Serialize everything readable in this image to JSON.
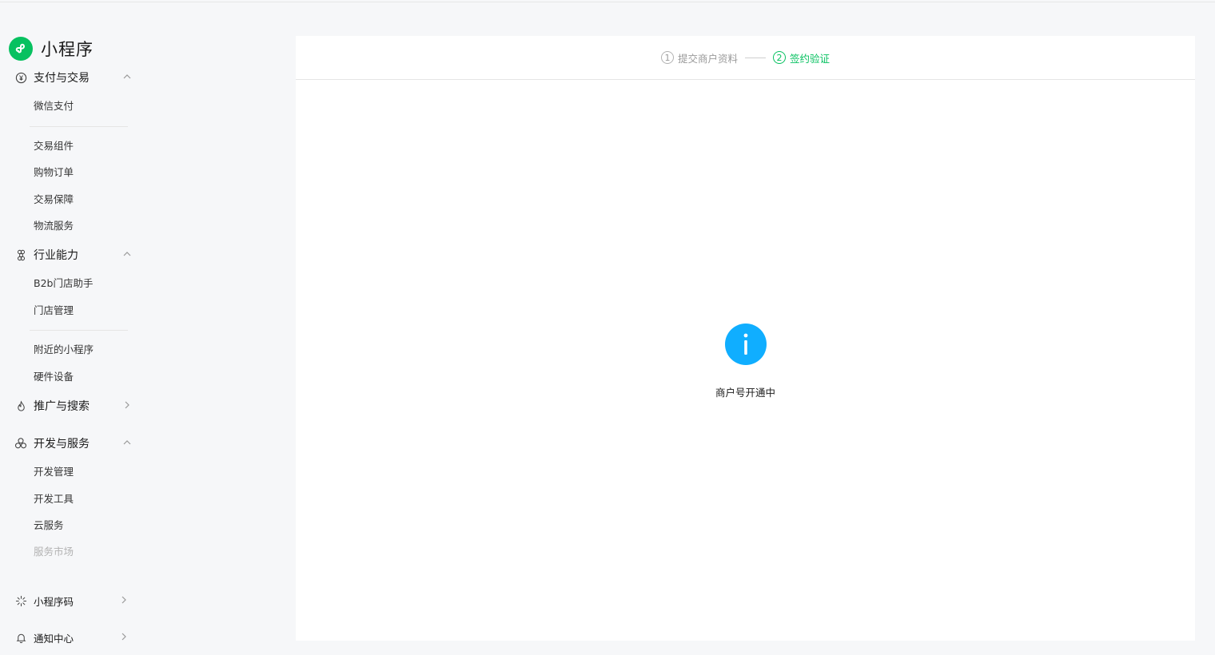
{
  "app": {
    "title": "小程序"
  },
  "sidebar": {
    "groups": [
      {
        "label": "支付与交易",
        "icon": "yen-circle-icon",
        "expanded": true,
        "items": [
          "微信支付",
          "交易组件",
          "购物订单",
          "交易保障",
          "物流服务"
        ]
      },
      {
        "label": "行业能力",
        "icon": "command-icon",
        "expanded": true,
        "items": [
          "B2b门店助手",
          "门店管理",
          "附近的小程序",
          "硬件设备"
        ]
      },
      {
        "label": "推广与搜索",
        "icon": "flame-icon",
        "expanded": false,
        "items": []
      },
      {
        "label": "开发与服务",
        "icon": "cluster-icon",
        "expanded": true,
        "items": [
          "开发管理",
          "开发工具",
          "云服务",
          "服务市场"
        ]
      },
      {
        "label": "小程序码",
        "icon": "sparkle-icon",
        "expanded": false,
        "items": []
      },
      {
        "label": "通知中心",
        "icon": "bell-icon",
        "expanded": false,
        "items": []
      }
    ]
  },
  "steps": [
    {
      "num": "1",
      "label": "提交商户资料",
      "active": false
    },
    {
      "num": "2",
      "label": "签约验证",
      "active": true
    }
  ],
  "status": {
    "icon": "info-icon",
    "text": "商户号开通中"
  },
  "colors": {
    "brand": "#07c160",
    "info": "#10aeff",
    "muted": "#b2b2b2"
  }
}
